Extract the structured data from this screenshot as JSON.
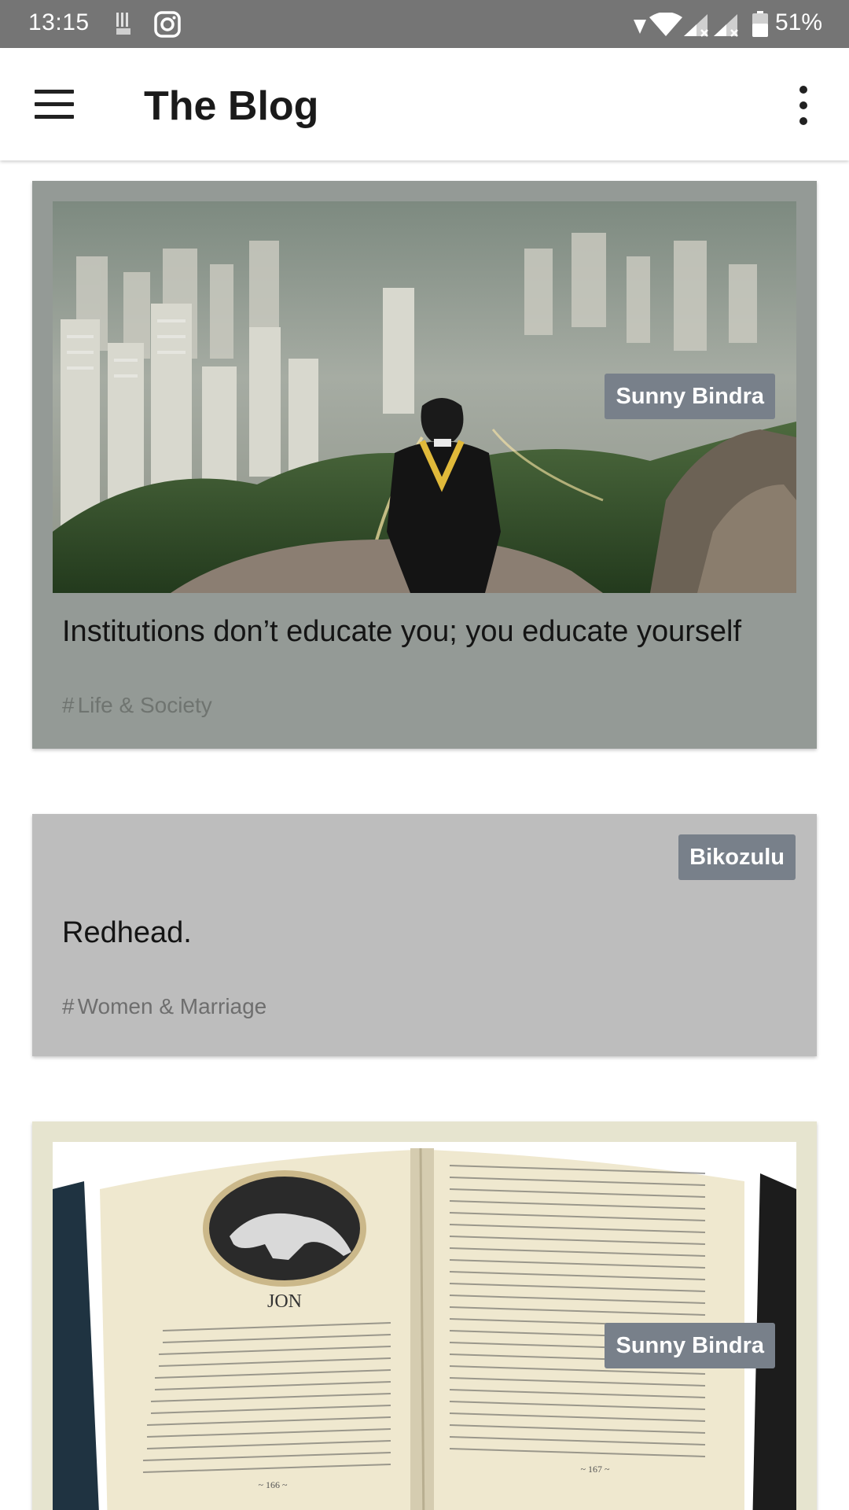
{
  "status_bar": {
    "time": "13:15",
    "battery_percent": "51%",
    "icons": [
      "notification-icon",
      "instagram-icon",
      "wifi-icon",
      "signal-icon",
      "signal-icon",
      "battery-icon"
    ]
  },
  "app_bar": {
    "title": "The Blog",
    "menu_icon": "hamburger-menu-icon",
    "overflow_icon": "more-vert-icon"
  },
  "posts": [
    {
      "author": "Sunny Bindra",
      "title": "Institutions don’t educate you; you educate yourself",
      "tag": "Life & Society",
      "has_image": true,
      "image": "graduate-overlooking-city-image",
      "card_color": "#949a96"
    },
    {
      "author": "Bikozulu",
      "title": "Redhead.",
      "tag": "Women & Marriage",
      "has_image": false,
      "card_color": "#bdbdbd"
    },
    {
      "author": "Sunny Bindra",
      "title": "",
      "tag": "",
      "has_image": true,
      "image": "open-book-image",
      "card_color": "#e6e4cf",
      "book": {
        "chapter_title": "JON",
        "left_page_number": "~ 166 ~",
        "right_page_number": "~ 167 ~"
      }
    }
  ],
  "tag_prefix": "#"
}
